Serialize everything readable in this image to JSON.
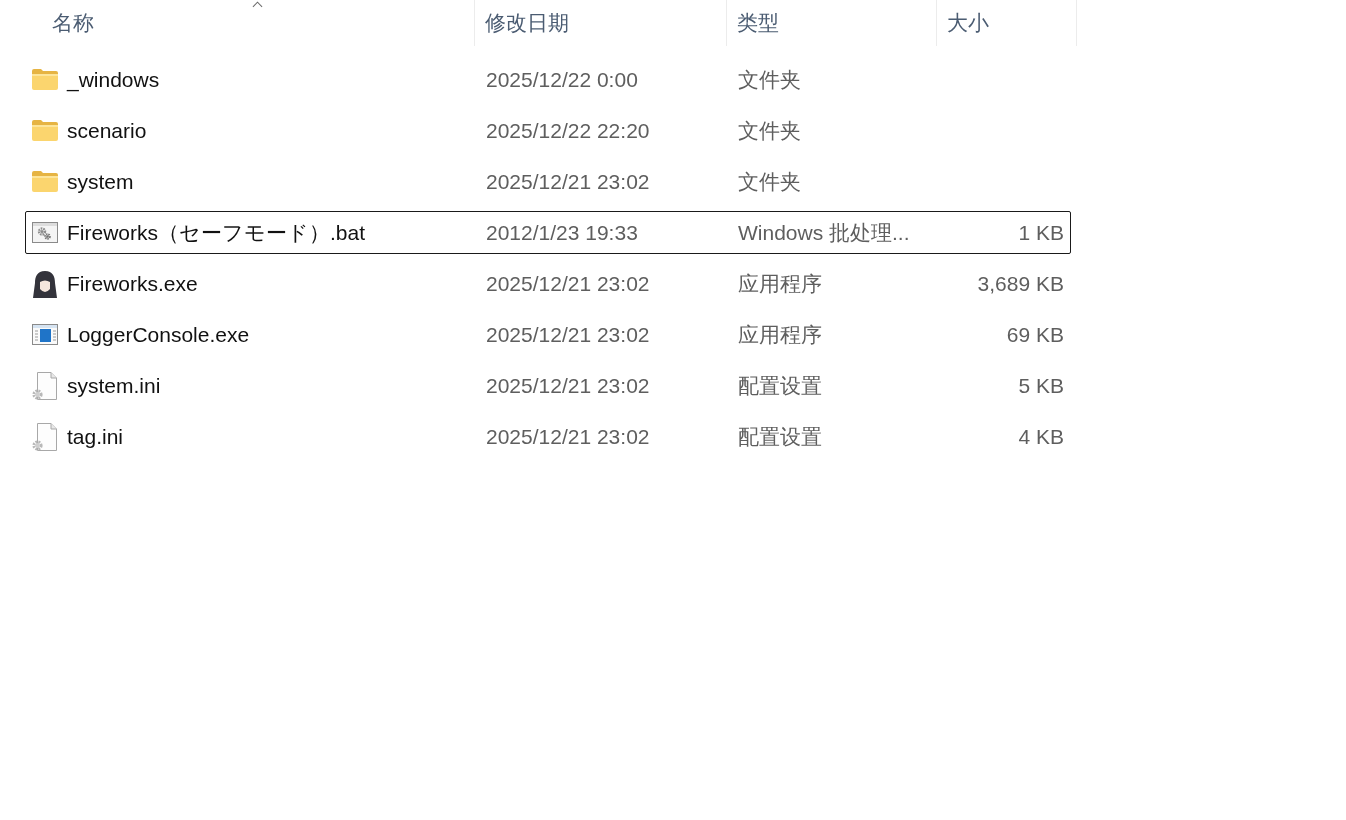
{
  "header": {
    "columns": [
      {
        "label": "名称",
        "sorted": true
      },
      {
        "label": "修改日期",
        "sorted": false
      },
      {
        "label": "类型",
        "sorted": false
      },
      {
        "label": "大小",
        "sorted": false
      }
    ]
  },
  "files": [
    {
      "kind": "folder",
      "name": "_windows",
      "modified": "2025/12/22 0:00",
      "type": "文件夹",
      "focused": false
    },
    {
      "kind": "folder",
      "name": "scenario",
      "modified": "2025/12/22 22:20",
      "type": "文件夹",
      "focused": false
    },
    {
      "kind": "folder",
      "name": "system",
      "modified": "2025/12/21 23:02",
      "type": "文件夹",
      "focused": false
    },
    {
      "kind": "batch",
      "name": "Fireworks（セーフモード）.bat",
      "modified": "2012/1/23 19:33",
      "type": "Windows 批处理...",
      "size": "1 KB",
      "focused": true
    },
    {
      "kind": "character-app",
      "name": "Fireworks.exe",
      "modified": "2025/12/21 23:02",
      "type": "应用程序",
      "size": "3,689 KB",
      "focused": false
    },
    {
      "kind": "window-app",
      "name": "LoggerConsole.exe",
      "modified": "2025/12/21 23:02",
      "type": "应用程序",
      "size": "69 KB",
      "focused": false
    },
    {
      "kind": "settings",
      "name": "system.ini",
      "modified": "2025/12/21 23:02",
      "type": "配置设置",
      "size": "5 KB",
      "focused": false
    },
    {
      "kind": "settings",
      "name": "tag.ini",
      "modified": "2025/12/21 23:02",
      "type": "配置设置",
      "size": "4 KB",
      "focused": false
    }
  ]
}
